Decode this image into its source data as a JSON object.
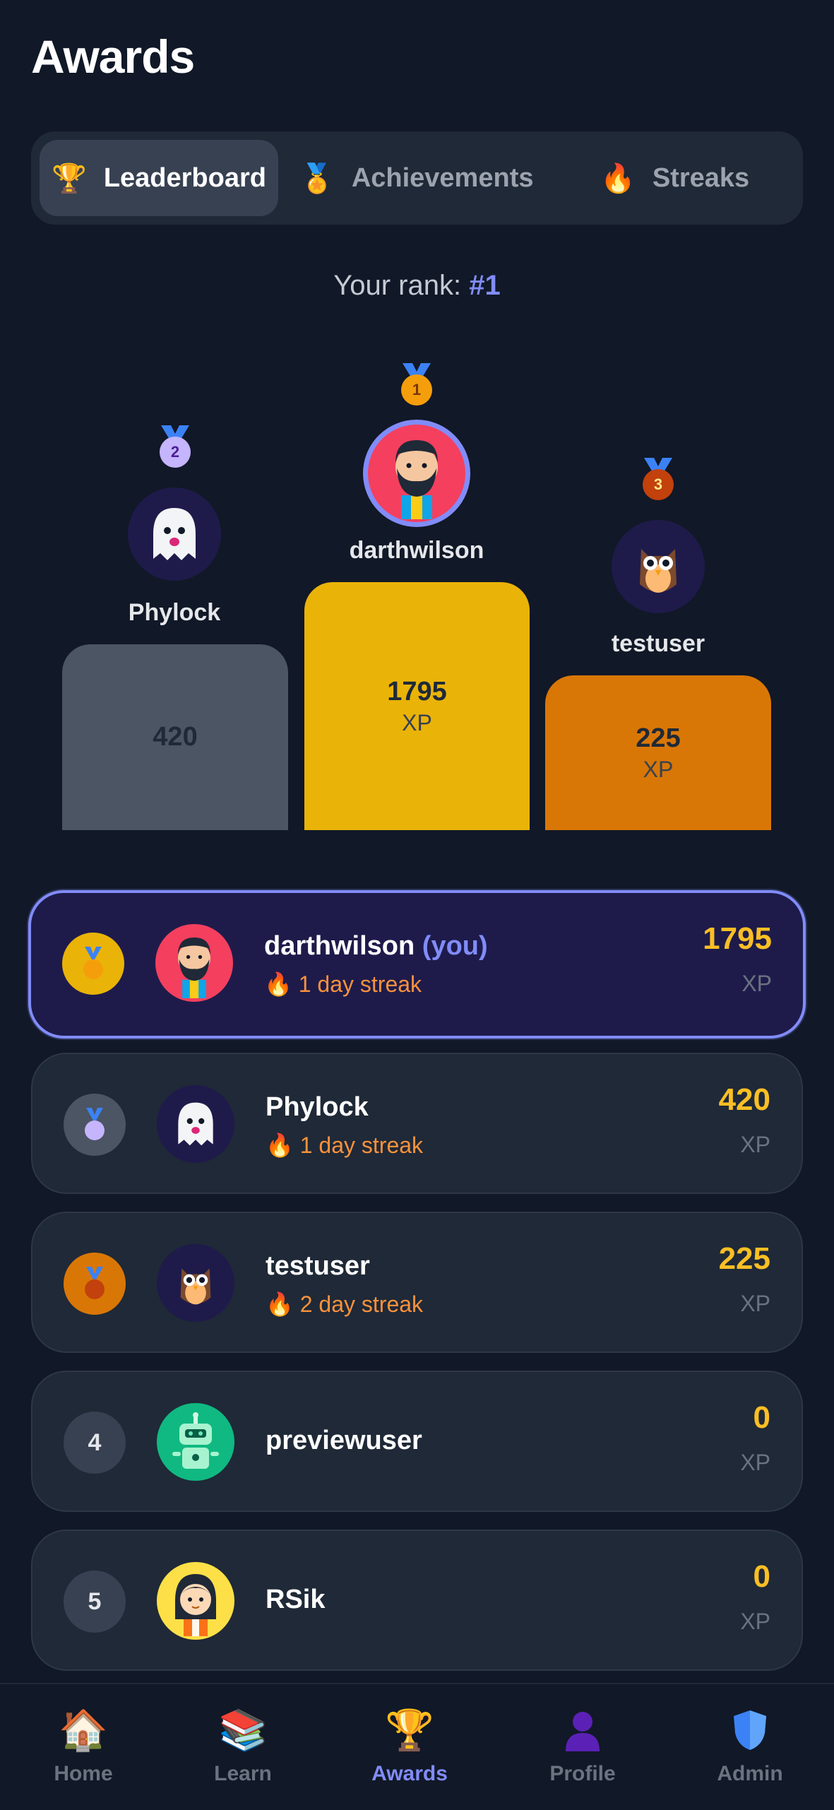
{
  "page": {
    "title": "Awards"
  },
  "tabs": [
    {
      "label": "Leaderboard",
      "icon": "trophy-icon",
      "glyph": "🏆",
      "active": true
    },
    {
      "label": "Achievements",
      "icon": "medal-icon",
      "glyph": "🏅",
      "active": false
    },
    {
      "label": "Streaks",
      "icon": "fire-icon",
      "glyph": "🔥",
      "active": false
    }
  ],
  "rank": {
    "prefix": "Your rank: ",
    "value": "#1"
  },
  "podium": {
    "first": {
      "place": "1",
      "name": "darthwilson",
      "xp": "1795",
      "unit": "XP",
      "avatar": "bearded-man-avatar"
    },
    "second": {
      "place": "2",
      "name": "Phylock",
      "xp": "420",
      "avatar": "ghost-avatar"
    },
    "third": {
      "place": "3",
      "name": "testuser",
      "xp": "225",
      "unit": "XP",
      "avatar": "owl-avatar"
    }
  },
  "leaderboard": [
    {
      "rank": "1",
      "name": "darthwilson",
      "you_label": "(you)",
      "streak": "1 day streak",
      "xp": "1795",
      "unit": "XP",
      "avatar": "bearded-man-avatar",
      "badge_color": "#eab308"
    },
    {
      "rank": "2",
      "name": "Phylock",
      "streak": "1 day streak",
      "xp": "420",
      "unit": "XP",
      "avatar": "ghost-avatar",
      "badge_color": "#4b5563"
    },
    {
      "rank": "3",
      "name": "testuser",
      "streak": "2 day streak",
      "xp": "225",
      "unit": "XP",
      "avatar": "owl-avatar",
      "badge_color": "#d97706"
    },
    {
      "rank": "4",
      "name": "previewuser",
      "xp": "0",
      "unit": "XP",
      "avatar": "robot-avatar",
      "badge_color": "#374151"
    },
    {
      "rank": "5",
      "name": "RSik",
      "xp": "0",
      "unit": "XP",
      "avatar": "girl-avatar",
      "badge_color": "#374151"
    }
  ],
  "nav": [
    {
      "label": "Home",
      "icon": "house-icon",
      "glyph": "🏠",
      "active": false
    },
    {
      "label": "Learn",
      "icon": "books-icon",
      "glyph": "📚",
      "active": false
    },
    {
      "label": "Awards",
      "icon": "trophy-icon",
      "glyph": "🏆",
      "active": true
    },
    {
      "label": "Profile",
      "icon": "person-icon",
      "glyph": "👤",
      "active": false
    },
    {
      "label": "Admin",
      "icon": "shield-icon",
      "glyph": "🛡",
      "active": false
    }
  ],
  "colors": {
    "accent": "#818cf8",
    "gold": "#eab308",
    "bronze": "#d97706",
    "silver": "#4b5563",
    "xp": "#fbbf24",
    "streak": "#fb923c"
  }
}
